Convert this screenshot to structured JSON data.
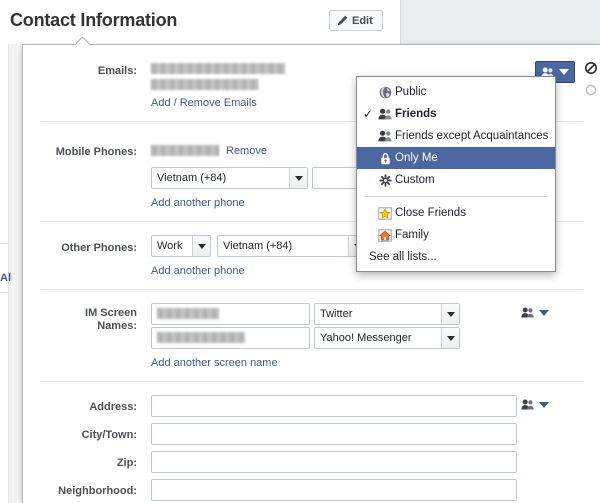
{
  "header": {
    "title": "Contact Information",
    "edit_label": "Edit",
    "edit_icon": "pencil-icon"
  },
  "background": {
    "left_label": "All"
  },
  "panel": {
    "rows": [
      {
        "id": "emails",
        "label": "Emails:",
        "value_redacted": true,
        "link": "Add / Remove Emails",
        "privacy_icon": "friends-icon",
        "privacy_state": "Friends"
      },
      {
        "id": "mobile-phones",
        "label": "Mobile Phones:",
        "value_redacted": true,
        "remove_label": "Remove",
        "country_select": "Vietnam (+84)",
        "number_value": "",
        "link": "Add another phone"
      },
      {
        "id": "other-phones",
        "label": "Other Phones:",
        "type_select": "Work",
        "country_select": "Vietnam (+84)",
        "number_value": "",
        "link": "Add another phone"
      },
      {
        "id": "im-screen-names",
        "label": "IM Screen\nNames:",
        "label_line1": "IM Screen",
        "label_line2": "Names:",
        "entries": [
          {
            "name_redacted": true,
            "service": "Twitter"
          },
          {
            "name_redacted": true,
            "service": "Yahoo! Messenger"
          }
        ],
        "link": "Add another screen name",
        "privacy_icon": "friends-icon"
      },
      {
        "id": "address",
        "label": "Address:",
        "value": "",
        "privacy_icon": "friends-icon"
      },
      {
        "id": "city-town",
        "label": "City/Town:",
        "value": ""
      },
      {
        "id": "zip",
        "label": "Zip:",
        "value": ""
      },
      {
        "id": "neighborhood",
        "label": "Neighborhood:",
        "value": ""
      }
    ],
    "side_controls": [
      {
        "icon": "blocked-icon",
        "caret": "chevron-down-icon"
      },
      {
        "icon": "circle-icon",
        "caret": "chevron-down-icon"
      }
    ]
  },
  "audience_menu": {
    "items": [
      {
        "label": "Public",
        "icon": "globe-icon",
        "checked": false,
        "selected": false,
        "bold": false
      },
      {
        "label": "Friends",
        "icon": "friends-icon",
        "checked": true,
        "selected": false,
        "bold": true
      },
      {
        "label": "Friends except Acquaintances",
        "icon": "friends-icon",
        "checked": false,
        "selected": false,
        "bold": false
      },
      {
        "label": "Only Me",
        "icon": "lock-icon",
        "checked": false,
        "selected": true,
        "bold": false
      },
      {
        "label": "Custom",
        "icon": "gear-icon",
        "checked": false,
        "selected": false,
        "bold": false
      }
    ],
    "list_items": [
      {
        "label": "Close Friends",
        "icon": "star-icon"
      },
      {
        "label": "Family",
        "icon": "house-icon"
      }
    ],
    "see_all": "See all lists..."
  },
  "colors": {
    "accent_blue": "#3b5998",
    "selected_blue": "#4b67a1",
    "link_blue": "#3b5998",
    "panel_border": "#b3b3b3",
    "input_border": "#bdc7d8",
    "star_yellow": "#f7c600",
    "house_orange": "#e8733a"
  }
}
